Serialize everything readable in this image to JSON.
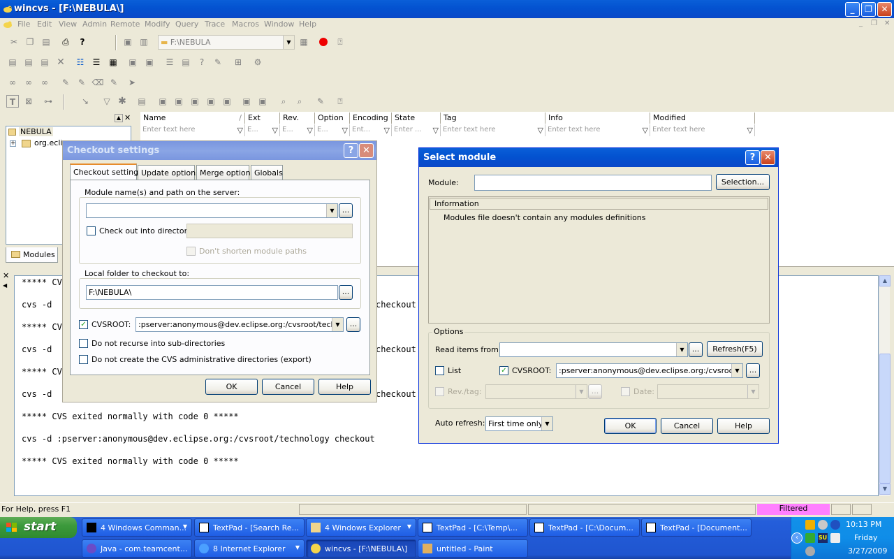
{
  "window": {
    "title": "wincvs - [F:\\NEBULA\\]"
  },
  "menu": [
    "File",
    "Edit",
    "View",
    "Admin",
    "Remote",
    "Modify",
    "Query",
    "Trace",
    "Macros",
    "Window",
    "Help"
  ],
  "toolbar": {
    "path_combo": "F:\\NEBULA"
  },
  "tree": {
    "root": "NEBULA",
    "child": "org.eclip",
    "tab_label": "Modules"
  },
  "columns": [
    {
      "name": "Name",
      "filter": "Enter text here"
    },
    {
      "name": "Ext",
      "filter": "E..."
    },
    {
      "name": "Rev.",
      "filter": "E..."
    },
    {
      "name": "Option",
      "filter": "E..."
    },
    {
      "name": "Encoding",
      "filter": "Ent..."
    },
    {
      "name": "State",
      "filter": "Enter ..."
    },
    {
      "name": "Tag",
      "filter": "Enter text here"
    },
    {
      "name": "Info",
      "filter": "Enter text here"
    },
    {
      "name": "Modified",
      "filter": "Enter text here"
    }
  ],
  "console": {
    "lines": [
      "***** CV",
      "cvs -d",
      "***** CV",
      "cvs -d",
      "***** CV",
      "cvs -d",
      "***** CVS exited normally with code 0 *****",
      "cvs -d :pserver:anonymous@dev.eclipse.org:/cvsroot/technology checkout",
      "***** CVS exited normally with code 0 *****"
    ],
    "checkout_fragment": "checkout"
  },
  "checkout_dialog": {
    "title": "Checkout settings",
    "tabs": [
      "Checkout settings",
      "Update options",
      "Merge options",
      "Globals"
    ],
    "module_group": "Module name(s) and path on the server:",
    "module_value": "",
    "checkout_into_dir": "Check out into directory:",
    "dont_shorten": "Don't shorten module paths",
    "local_folder_group": "Local folder to checkout to:",
    "local_folder": "F:\\NEBULA\\",
    "cvsroot_label": "CVSROOT:",
    "cvsroot_value": ":pserver:anonymous@dev.eclipse.org:/cvsroot/technology",
    "no_recurse": "Do not recurse into sub-directories",
    "no_admin": "Do not create the CVS administrative directories (export)",
    "ok": "OK",
    "cancel": "Cancel",
    "help": "Help",
    "browse": "..."
  },
  "select_dialog": {
    "title": "Select module",
    "module_label": "Module:",
    "module_value": "",
    "selection_btn": "Selection...",
    "info_header": "Information",
    "info_text": "Modules file doesn't contain any modules definitions",
    "options_group": "Options",
    "read_items": "Read items from:",
    "refresh_btn": "Refresh(F5)",
    "list_label": "List",
    "cvsroot_label": "CVSROOT:",
    "cvsroot_value": ":pserver:anonymous@dev.eclipse.org:/cvsroot/tech",
    "rev_tag": "Rev./tag:",
    "date": "Date:",
    "auto_refresh": "Auto refresh:",
    "auto_refresh_value": "First time only",
    "ok": "OK",
    "cancel": "Cancel",
    "help": "Help",
    "browse": "..."
  },
  "statusbar": {
    "help": "For Help, press F1",
    "filtered": "Filtered"
  },
  "taskbar": {
    "start": "start",
    "row1": [
      "4 Windows Comman...",
      "TextPad - [Search Re...",
      "4 Windows Explorer",
      "TextPad - [C:\\Temp\\...",
      "TextPad - [C:\\Docum...",
      "TextPad - [Document..."
    ],
    "row2": [
      "Java - com.teamcent...",
      "8 Internet Explorer",
      "wincvs - [F:\\NEBULA\\]",
      "untitled - Paint"
    ],
    "time": "10:13 PM",
    "day": "Friday",
    "date": "3/27/2009"
  },
  "colors": {
    "title_blue": "#0352d0",
    "dialog_bg": "#ece9d8",
    "filtered_pink": "#ff80ff",
    "taskbar": "#245edb",
    "tray": "#0f8de8",
    "start": "#3c9a3c"
  }
}
